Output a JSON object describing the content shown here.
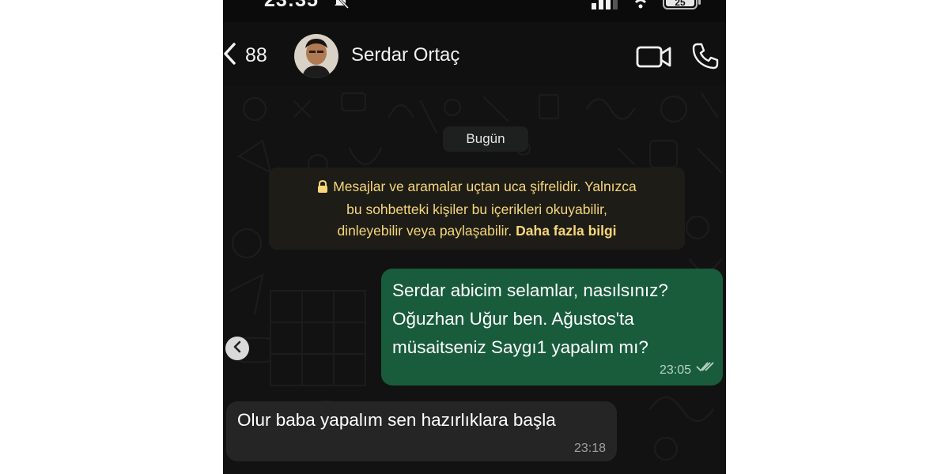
{
  "status_bar": {
    "time": "23:35",
    "battery": "25"
  },
  "header": {
    "back_count": "88",
    "contact_name": "Serdar Ortaç"
  },
  "chat": {
    "date_chip": "Bugün",
    "encryption_notice": {
      "line1": "Mesajlar ve aramalar uçtan uca şifrelidir. Yalnızca",
      "line2": "bu sohbetteki kişiler bu içerikleri okuyabilir,",
      "line3": "dinleyebilir veya paylaşabilir.",
      "link": "Daha fazla bilgi"
    },
    "messages": [
      {
        "direction": "outgoing",
        "lines": [
          "Serdar abicim selamlar, nasılsınız?",
          "Oğuzhan Uğur ben. Ağustos'ta",
          "müsaitseniz Saygı1 yapalım mı?"
        ],
        "time": "23:05",
        "status": "read"
      },
      {
        "direction": "incoming",
        "lines": [
          "Olur baba yapalım sen hazırlıklara başla"
        ],
        "time": "23:18"
      }
    ]
  },
  "colors": {
    "background": "#0b0b0b",
    "outgoing_bubble": "#195c3c",
    "incoming_bubble": "#252525",
    "notice_text": "#f7d77a"
  }
}
